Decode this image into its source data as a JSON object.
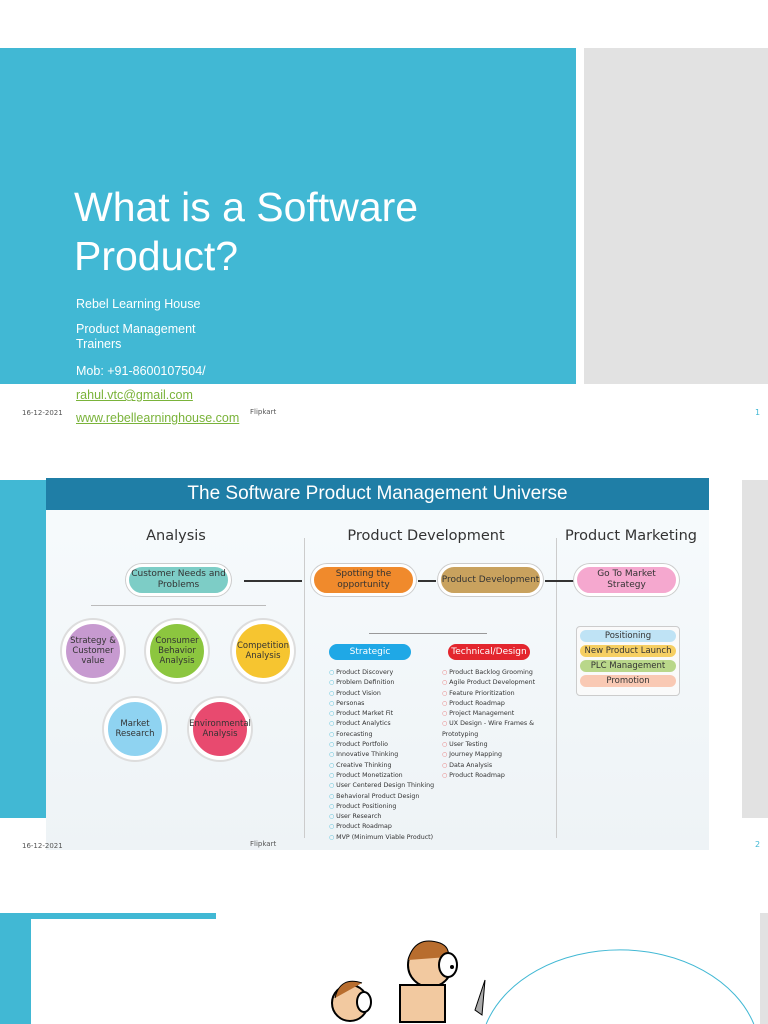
{
  "slide1": {
    "title": "What is a Software Product?",
    "lines": [
      "Rebel Learning House",
      "Product Management Trainers",
      "Mob: +91-8600107504/"
    ],
    "email": "rahul.vtc@gmail.com",
    "website": "www.rebellearninghouse.com",
    "footer_date": "16-12-2021",
    "footer_text": "Flipkart",
    "page": "1"
  },
  "slide2": {
    "banner": "The Software Product Management Universe",
    "sections": {
      "analysis": "Analysis",
      "development": "Product Development",
      "marketing": "Product Marketing"
    },
    "analysis": {
      "root": "Customer Needs and Problems",
      "nodes": [
        "Strategy & Customer value",
        "Consumer Behavior Analysis",
        "Competition Analysis",
        "Market Research",
        "Environmental Analysis"
      ]
    },
    "development": {
      "steps": [
        "Spotting the opportunity",
        "Product Development"
      ],
      "strategic": {
        "label": "Strategic",
        "items": [
          "Product Discovery",
          "Problem Definition",
          "Product Vision",
          "Personas",
          "Product Market Fit",
          "Product Analytics",
          "Forecasting",
          "Product Portfolio",
          "Innovative Thinking",
          "Creative Thinking",
          "Product Monetization",
          "User Centered Design Thinking",
          "Behavioral Product Design",
          "Product Positioning",
          "User Research",
          "Product Roadmap",
          "MVP (Minimum Viable Product)"
        ]
      },
      "technical": {
        "label": "Technical/Design",
        "items": [
          "Product Backlog Grooming",
          "Agile Product Development",
          "Feature Prioritization",
          "Product Roadmap",
          "Project Management",
          "UX Design - Wire Frames & Prototyping",
          "User Testing",
          "Journey Mapping",
          "Data Analysis",
          "Product Roadmap"
        ]
      }
    },
    "marketing": {
      "root": "Go To Market Strategy",
      "items": [
        "Positioning",
        "New Product Launch",
        "PLC Management",
        "Promotion"
      ]
    },
    "footer_date": "16-12-2021",
    "footer_text": "Flipkart",
    "page": "2"
  },
  "colors": {
    "accent": "#41b8d4",
    "link": "#7ab33a"
  }
}
